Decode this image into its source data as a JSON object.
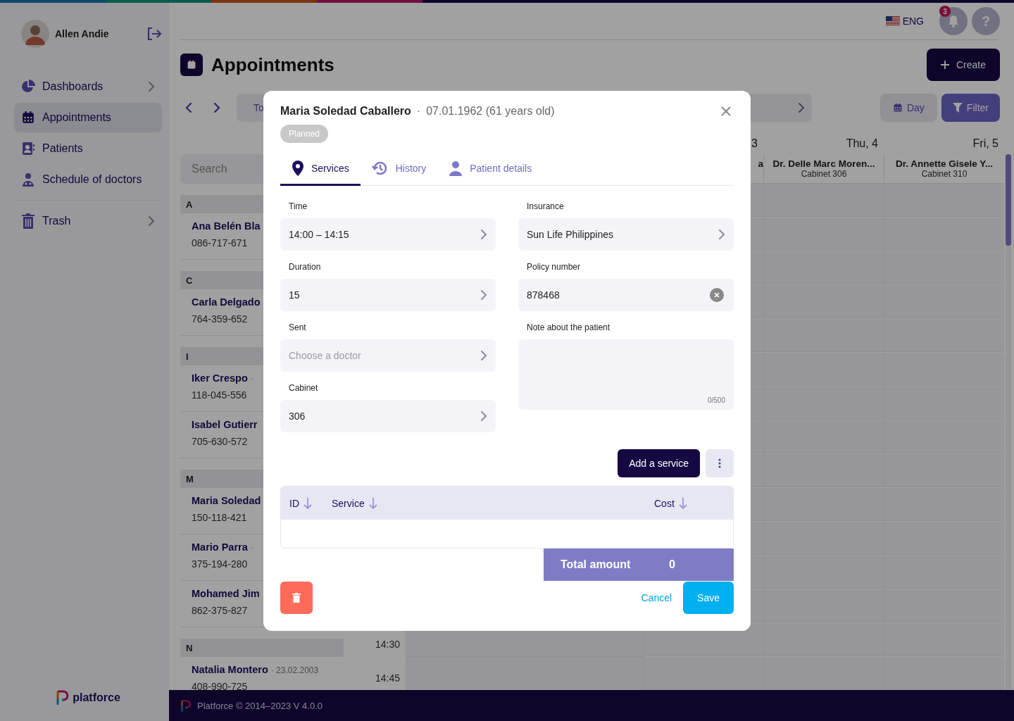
{
  "user": {
    "name": "Allen Andie"
  },
  "nav": [
    {
      "label": "Dashboards",
      "selected": false,
      "expandable": true
    },
    {
      "label": "Appointments",
      "selected": true,
      "expandable": false
    },
    {
      "label": "Patients",
      "selected": false,
      "expandable": false
    },
    {
      "label": "Schedule of doctors",
      "selected": false,
      "expandable": false
    },
    {
      "label": "Trash",
      "selected": false,
      "expandable": true
    }
  ],
  "sidebar_logo": "platforce",
  "header": {
    "language": "ENG",
    "notification_count": "3",
    "help": "?"
  },
  "page": {
    "title": "Appointments",
    "create_button": "Create",
    "today_button": "To",
    "view_button": "Day",
    "filter_button": "Filter"
  },
  "search": {
    "placeholder": "Search"
  },
  "patient_groups": [
    {
      "letter": "A",
      "patients": [
        {
          "name": "Ana Belén Bla",
          "phone": "086-717-671"
        }
      ]
    },
    {
      "letter": "C",
      "patients": [
        {
          "name": "Carla Delgado",
          "phone": "764-359-652"
        }
      ]
    },
    {
      "letter": "I",
      "patients": [
        {
          "name": "Iker Crespo",
          "meta": "·",
          "phone": "118-045-556"
        },
        {
          "name": "Isabel Gutierr",
          "phone": "705-630-572"
        }
      ]
    },
    {
      "letter": "M",
      "patients": [
        {
          "name": "Maria Soledad",
          "phone": "150-118-421"
        },
        {
          "name": "Mario Parra",
          "meta": "·",
          "phone": "375-194-280"
        },
        {
          "name": "Mohamed Jim",
          "phone": "862-375-827"
        }
      ]
    },
    {
      "letter": "N",
      "patients": [
        {
          "name": "Natalia Montero",
          "meta": "· 23.02.2003",
          "phone": "408-990-725"
        }
      ]
    }
  ],
  "calendar": {
    "columns": [
      {
        "day": "3",
        "doctor": "a"
      },
      {
        "day": "Thu, 4",
        "doctor": "Dr. Delle Marc Moren...",
        "cabinet": "Cabinet 306"
      },
      {
        "day": "Fri, 5",
        "doctor": "Dr. Annette Gisele Y...",
        "cabinet": "Cabinet 310"
      }
    ],
    "time_labels": [
      "14:30",
      "14:45"
    ]
  },
  "footer": "Platforce © 2014–2023 V 4.0.0",
  "modal": {
    "patient": "Maria Soledad Caballero",
    "separator": "·",
    "birth": "07.01.1962 (61 years old)",
    "status": "Planned",
    "tabs": [
      {
        "label": "Services",
        "selected": true
      },
      {
        "label": "History",
        "selected": false
      },
      {
        "label": "Patient details",
        "selected": false
      }
    ],
    "left_fields": [
      {
        "kind": "select",
        "label": "Time",
        "value": "14:00 – 14:15"
      },
      {
        "kind": "select",
        "label": "Duration",
        "value": "15"
      },
      {
        "kind": "select",
        "label": "Sent",
        "placeholder": "Choose a doctor"
      },
      {
        "kind": "select",
        "label": "Cabinet",
        "value": "306"
      }
    ],
    "right_fields": [
      {
        "kind": "select",
        "label": "Insurance",
        "value": "Sun Life Philippines"
      },
      {
        "kind": "clearable",
        "label": "Policy number",
        "value": "878468"
      },
      {
        "kind": "textarea",
        "label": "Note about the patient",
        "counter": "0/500"
      }
    ],
    "add_service_button": "Add a service",
    "table_columns": [
      "ID",
      "Service",
      "Cost"
    ],
    "total_label": "Total amount",
    "total_value": "0",
    "cancel_button": "Cancel",
    "save_button": "Save"
  }
}
